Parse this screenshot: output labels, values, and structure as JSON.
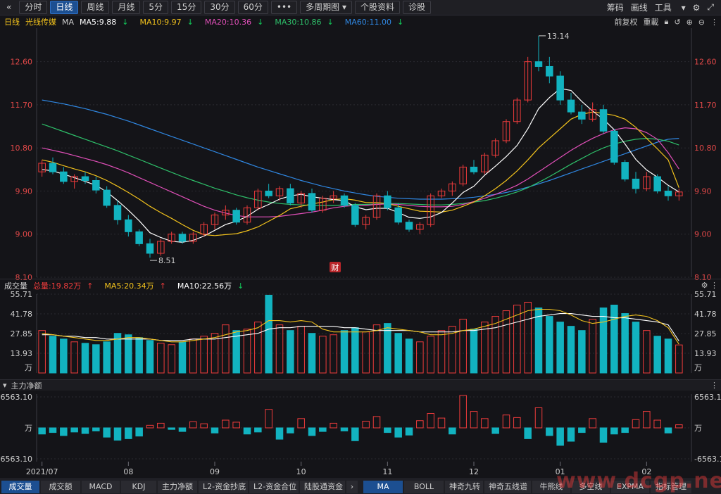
{
  "toolbar": {
    "back_icon": "back-chevron-icon",
    "periods": [
      "分时",
      "日线",
      "周线",
      "月线",
      "5分",
      "15分",
      "30分",
      "60分"
    ],
    "active_period": "日线",
    "more_label": "•••",
    "multi_label": "多周期图",
    "profile_label": "个股资料",
    "diagnose_label": "诊股",
    "right": [
      "筹码",
      "画线",
      "工具"
    ]
  },
  "info": {
    "period": "日线",
    "stock": "光线传媒",
    "ma_label": "MA",
    "ma5": "MA5:9.88",
    "ma10": "MA10:9.97",
    "ma20": "MA20:10.36",
    "ma30": "MA30:10.86",
    "ma60": "MA60:11.00",
    "fq_label": "前复权",
    "overlay_label": "重載"
  },
  "colors": {
    "up": "#f03c3c",
    "down": "#12b3c0",
    "ma5": "#ffffff",
    "ma10": "#f2c21c",
    "ma20": "#e04fb8",
    "ma30": "#2ec06a",
    "ma60": "#2f86e0",
    "axis": "#e04848",
    "grid": "#2a2a30"
  },
  "price_axis": {
    "ticks": [
      "12.60",
      "11.70",
      "10.80",
      "9.90",
      "9.00",
      "8.10"
    ],
    "range": [
      8.1,
      13.3
    ]
  },
  "annotations": {
    "high": "13.14",
    "low": "8.51",
    "event": "财"
  },
  "candles": [
    [
      10.3,
      10.55,
      10.2,
      10.48
    ],
    [
      10.48,
      10.6,
      10.25,
      10.3
    ],
    [
      10.3,
      10.4,
      10.05,
      10.1
    ],
    [
      10.1,
      10.25,
      9.95,
      10.2
    ],
    [
      10.2,
      10.3,
      10.05,
      10.12
    ],
    [
      10.12,
      10.2,
      9.85,
      9.92
    ],
    [
      9.92,
      10.0,
      9.55,
      9.6
    ],
    [
      9.6,
      9.7,
      9.2,
      9.3
    ],
    [
      9.3,
      9.4,
      8.95,
      9.05
    ],
    [
      9.05,
      9.1,
      8.75,
      8.8
    ],
    [
      8.8,
      8.9,
      8.51,
      8.6
    ],
    [
      8.6,
      8.9,
      8.55,
      8.85
    ],
    [
      8.85,
      9.05,
      8.8,
      9.0
    ],
    [
      9.0,
      9.05,
      8.8,
      8.85
    ],
    [
      8.85,
      9.05,
      8.8,
      9.0
    ],
    [
      9.0,
      9.25,
      8.95,
      9.2
    ],
    [
      9.2,
      9.45,
      9.1,
      9.4
    ],
    [
      9.4,
      9.6,
      9.3,
      9.5
    ],
    [
      9.5,
      9.55,
      9.2,
      9.25
    ],
    [
      9.25,
      9.6,
      9.2,
      9.55
    ],
    [
      9.55,
      9.95,
      9.5,
      9.9
    ],
    [
      9.9,
      10.05,
      9.75,
      9.8
    ],
    [
      9.8,
      10.0,
      9.7,
      9.95
    ],
    [
      9.95,
      10.05,
      9.6,
      9.65
    ],
    [
      9.65,
      9.9,
      9.55,
      9.85
    ],
    [
      9.85,
      9.95,
      9.45,
      9.5
    ],
    [
      9.5,
      9.8,
      9.45,
      9.75
    ],
    [
      9.75,
      9.9,
      9.65,
      9.8
    ],
    [
      9.8,
      9.85,
      9.55,
      9.6
    ],
    [
      9.6,
      9.65,
      9.15,
      9.2
    ],
    [
      9.2,
      9.4,
      9.1,
      9.35
    ],
    [
      9.35,
      9.85,
      9.3,
      9.8
    ],
    [
      9.8,
      9.9,
      9.5,
      9.55
    ],
    [
      9.55,
      9.65,
      9.2,
      9.25
    ],
    [
      9.25,
      9.3,
      9.05,
      9.1
    ],
    [
      9.1,
      9.25,
      9.0,
      9.2
    ],
    [
      9.2,
      9.85,
      9.15,
      9.8
    ],
    [
      9.8,
      9.95,
      9.75,
      9.9
    ],
    [
      9.9,
      10.1,
      9.8,
      10.05
    ],
    [
      10.05,
      10.45,
      10.0,
      10.4
    ],
    [
      10.4,
      10.55,
      10.25,
      10.3
    ],
    [
      10.3,
      10.7,
      10.25,
      10.65
    ],
    [
      10.65,
      11.0,
      10.6,
      10.95
    ],
    [
      10.95,
      11.4,
      10.9,
      11.35
    ],
    [
      11.35,
      11.85,
      11.3,
      11.8
    ],
    [
      11.8,
      12.7,
      11.75,
      12.6
    ],
    [
      12.6,
      13.14,
      12.4,
      12.5
    ],
    [
      12.5,
      12.7,
      12.15,
      12.3
    ],
    [
      12.3,
      12.4,
      11.7,
      11.8
    ],
    [
      11.8,
      11.95,
      11.5,
      11.55
    ],
    [
      11.55,
      11.7,
      11.3,
      11.4
    ],
    [
      11.4,
      11.75,
      11.35,
      11.6
    ],
    [
      11.6,
      11.7,
      11.1,
      11.15
    ],
    [
      11.15,
      11.2,
      10.45,
      10.5
    ],
    [
      10.5,
      10.55,
      10.1,
      10.15
    ],
    [
      10.15,
      10.3,
      9.85,
      9.95
    ],
    [
      9.95,
      10.3,
      9.9,
      10.2
    ],
    [
      10.2,
      10.25,
      9.85,
      9.9
    ],
    [
      9.9,
      10.0,
      9.7,
      9.8
    ],
    [
      9.8,
      9.95,
      9.7,
      9.88
    ]
  ],
  "ma_series": {
    "ma5": [
      10.35,
      10.32,
      10.25,
      10.18,
      10.1,
      10.02,
      9.88,
      9.7,
      9.5,
      9.28,
      9.03,
      8.93,
      8.85,
      8.83,
      8.87,
      8.96,
      9.08,
      9.2,
      9.27,
      9.37,
      9.52,
      9.62,
      9.73,
      9.8,
      9.83,
      9.78,
      9.75,
      9.72,
      9.7,
      9.57,
      9.51,
      9.54,
      9.54,
      9.45,
      9.35,
      9.33,
      9.36,
      9.45,
      9.65,
      9.87,
      10.0,
      10.23,
      10.42,
      10.62,
      10.85,
      11.2,
      11.62,
      11.85,
      12.04,
      12.0,
      11.77,
      11.57,
      11.4,
      11.18,
      10.88,
      10.56,
      10.34,
      10.19,
      10.02,
      9.88
    ],
    "ma10": [
      10.55,
      10.5,
      10.43,
      10.36,
      10.3,
      10.22,
      10.12,
      10.0,
      9.87,
      9.73,
      9.58,
      9.45,
      9.33,
      9.2,
      9.08,
      8.99,
      8.97,
      8.99,
      9.01,
      9.07,
      9.15,
      9.27,
      9.39,
      9.53,
      9.58,
      9.63,
      9.67,
      9.72,
      9.74,
      9.71,
      9.66,
      9.66,
      9.64,
      9.58,
      9.53,
      9.48,
      9.47,
      9.46,
      9.5,
      9.58,
      9.67,
      9.8,
      9.95,
      10.12,
      10.32,
      10.55,
      10.8,
      11.0,
      11.2,
      11.4,
      11.5,
      11.55,
      11.52,
      11.48,
      11.4,
      11.23,
      11.0,
      10.78,
      10.55,
      9.97
    ],
    "ma20": [
      10.8,
      10.75,
      10.7,
      10.64,
      10.58,
      10.52,
      10.45,
      10.37,
      10.28,
      10.18,
      10.08,
      9.98,
      9.88,
      9.78,
      9.68,
      9.58,
      9.5,
      9.44,
      9.39,
      9.36,
      9.36,
      9.36,
      9.37,
      9.4,
      9.43,
      9.46,
      9.5,
      9.55,
      9.58,
      9.6,
      9.6,
      9.62,
      9.63,
      9.62,
      9.6,
      9.58,
      9.57,
      9.57,
      9.58,
      9.62,
      9.68,
      9.75,
      9.83,
      9.92,
      10.02,
      10.15,
      10.3,
      10.45,
      10.6,
      10.75,
      10.88,
      11.0,
      11.1,
      11.18,
      11.22,
      11.2,
      11.12,
      10.98,
      10.7,
      10.36
    ],
    "ma30": [
      11.3,
      11.22,
      11.14,
      11.06,
      10.98,
      10.9,
      10.82,
      10.74,
      10.65,
      10.56,
      10.47,
      10.38,
      10.29,
      10.2,
      10.12,
      10.04,
      9.96,
      9.89,
      9.82,
      9.76,
      9.71,
      9.67,
      9.64,
      9.62,
      9.61,
      9.6,
      9.6,
      9.6,
      9.61,
      9.62,
      9.62,
      9.63,
      9.64,
      9.64,
      9.63,
      9.62,
      9.61,
      9.61,
      9.62,
      9.64,
      9.67,
      9.7,
      9.75,
      9.81,
      9.88,
      9.97,
      10.08,
      10.2,
      10.33,
      10.46,
      10.58,
      10.7,
      10.8,
      10.88,
      10.94,
      10.98,
      11.0,
      10.98,
      10.94,
      10.86
    ],
    "ma60": [
      11.8,
      11.76,
      11.72,
      11.67,
      11.62,
      11.56,
      11.5,
      11.43,
      11.36,
      11.28,
      11.2,
      11.12,
      11.04,
      10.96,
      10.88,
      10.8,
      10.72,
      10.64,
      10.56,
      10.48,
      10.4,
      10.33,
      10.26,
      10.19,
      10.12,
      10.06,
      10.0,
      9.95,
      9.9,
      9.86,
      9.82,
      9.79,
      9.77,
      9.75,
      9.74,
      9.73,
      9.73,
      9.73,
      9.74,
      9.75,
      9.77,
      9.8,
      9.83,
      9.87,
      9.92,
      9.98,
      10.05,
      10.12,
      10.2,
      10.28,
      10.36,
      10.44,
      10.52,
      10.6,
      10.68,
      10.76,
      10.84,
      10.92,
      10.98,
      11.0
    ]
  },
  "volume": {
    "title": "成交量",
    "total": "总量:19.82万",
    "ma5": "MA5:20.34万",
    "ma10": "MA10:22.56万",
    "ticks": [
      "55.71",
      "41.78",
      "27.85",
      "13.93",
      "万"
    ],
    "max": 55.71,
    "values": [
      30,
      26,
      24,
      22,
      21,
      20,
      22,
      28,
      27,
      25,
      23,
      21,
      20,
      22,
      24,
      26,
      28,
      34,
      30,
      31,
      36,
      55,
      34,
      30,
      33,
      28,
      26,
      27,
      30,
      32,
      29,
      34,
      35,
      28,
      24,
      22,
      26,
      30,
      33,
      38,
      31,
      36,
      40,
      44,
      48,
      50,
      46,
      40,
      36,
      33,
      30,
      38,
      46,
      48,
      42,
      36,
      30,
      26,
      24,
      19.82
    ],
    "ma5_line": [
      28,
      27,
      26,
      25,
      24,
      23,
      23,
      24,
      25,
      25,
      24,
      23,
      22,
      22,
      23,
      24,
      25,
      27,
      29,
      30,
      32,
      37,
      37,
      36,
      37,
      36,
      31,
      29,
      29,
      29,
      29,
      30,
      32,
      31,
      30,
      29,
      27,
      27,
      28,
      30,
      31,
      33,
      35,
      38,
      41,
      44,
      45,
      45,
      44,
      41,
      37,
      35,
      36,
      38,
      40,
      41,
      40,
      37,
      32,
      20.34
    ],
    "ma10_line": [
      27,
      27,
      26,
      26,
      25,
      25,
      24,
      24,
      24,
      24,
      24,
      23,
      23,
      23,
      24,
      24,
      24,
      25,
      26,
      27,
      28,
      31,
      32,
      32,
      33,
      33,
      33,
      33,
      32,
      32,
      31,
      30,
      30,
      30,
      30,
      29,
      29,
      29,
      29,
      30,
      30,
      31,
      32,
      34,
      36,
      38,
      40,
      41,
      42,
      42,
      41,
      40,
      40,
      39,
      39,
      38,
      37,
      36,
      34,
      22.56
    ]
  },
  "money": {
    "title": "主力净额",
    "ticks": [
      "6563.10",
      "万",
      "-6563.10"
    ],
    "max": 6563.1,
    "values": [
      -1200,
      -900,
      -1500,
      -800,
      -1100,
      -600,
      -1800,
      -2400,
      -2100,
      -1600,
      500,
      900,
      -300,
      -700,
      1200,
      800,
      -1000,
      1500,
      1100,
      -1200,
      -800,
      3600,
      -2200,
      -1000,
      1800,
      -1500,
      -700,
      900,
      -600,
      -2500,
      1300,
      2200,
      -900,
      -1800,
      -1400,
      1400,
      2800,
      1900,
      -1200,
      6300,
      3200,
      1800,
      -1100,
      2500,
      2000,
      -2100,
      3900,
      -1500,
      -3400,
      -2600,
      -900,
      1800,
      -2800,
      -1200,
      -900,
      1600,
      3200,
      1500,
      -1000,
      600
    ]
  },
  "date_axis": [
    "2021/07",
    "08",
    "09",
    "10",
    "11",
    "12",
    "01",
    "02"
  ],
  "tabs_left": [
    "成交量",
    "成交额",
    "MACD",
    "KDJ",
    "主力净额",
    "L2-资金抄底",
    "L2-资金合位",
    "陆股通资金"
  ],
  "tabs_right": [
    "MA",
    "BOLL",
    "神奇九转",
    "神奇五线谱",
    "牛熊线",
    "多空线",
    "EXPMA",
    "指标管理"
  ],
  "active_tab_left": "成交量",
  "active_tab_right": "MA",
  "watermark": "www.dcgp.net"
}
